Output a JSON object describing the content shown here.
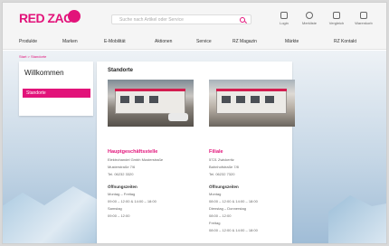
{
  "brand": {
    "logo_text": "RED ZAC"
  },
  "search": {
    "placeholder": "Suche nach Artikel oder Service"
  },
  "utility": [
    {
      "icon": "user-icon",
      "label": "Login"
    },
    {
      "icon": "heart-icon",
      "label": "Merkliste"
    },
    {
      "icon": "compare-icon",
      "label": "Vergleich"
    },
    {
      "icon": "cart-icon",
      "label": "Warenkorb"
    }
  ],
  "nav": [
    "Produkte",
    "Marken",
    "E-Mobilität",
    "Aktionen",
    "Service",
    "RZ Magazin",
    "Märkte",
    "RZ Kontakt"
  ],
  "breadcrumb": "Start > Standorte",
  "sidebar": {
    "title": "Willkommen",
    "active_item": "Standorte"
  },
  "main": {
    "title": "Standorte",
    "stores": [
      {
        "name": "Hauptgeschäftsstelle",
        "address1": "Elektrohandel Gmbh Musterstraße",
        "address2": "Musterstraße 7/6",
        "phone": "Tel. 06232 3320",
        "hours_title": "Öffnungszeiten",
        "hours_line1": "Montag – Freitag",
        "hours_line2": "09:00 – 12:00 & 14:00 – 18:00",
        "hours_line3": "Samstag",
        "hours_line4": "09:00 – 12:00"
      },
      {
        "name": "Filiale",
        "address1": "5721 Zwickeritz",
        "address2": "Bahnhofstraße 7/8",
        "phone": "Tel. 06232 7320",
        "hours_title": "Öffnungszeiten",
        "hours_line1": "Montag",
        "hours_line2": "08:00 – 12:00 & 14:00 – 18:00",
        "hours_line3": "Dienstag – Donnerstag",
        "hours_line4": "08:00 – 12:00",
        "hours_line5": "Freitag",
        "hours_line6": "08:00 – 12:00 & 14:00 – 18:00"
      }
    ]
  }
}
